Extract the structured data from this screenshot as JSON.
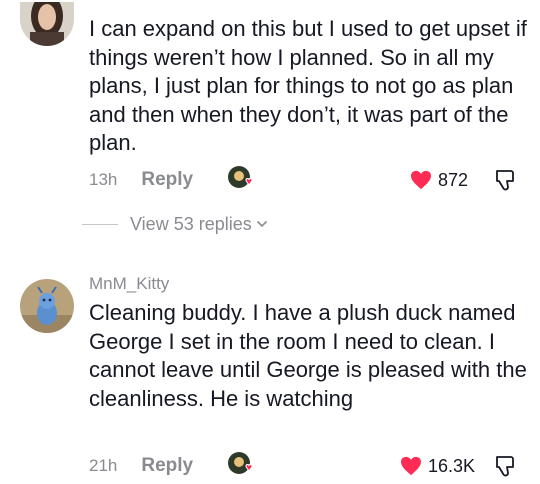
{
  "comments": [
    {
      "username": "",
      "text": "I can expand on this but I used to get upset if things weren’t how I planned. So in all my plans, I just plan for things to not go as plan and then when they don’t, it was part of the plan.",
      "time": "13h",
      "reply_label": "Reply",
      "like_count": "872",
      "view_replies_label": "View 53 replies"
    },
    {
      "username": "MnM_Kitty",
      "text": "Cleaning buddy. I have a plush duck named George I set in the room I need to clean. I cannot leave until George is pleased with the cleanliness. He is watching",
      "time": "21h",
      "reply_label": "Reply",
      "like_count": "16.3K"
    }
  ],
  "colors": {
    "heart": "#fe2c55",
    "muted_text": "#8a8b91",
    "primary_text": "#161823"
  },
  "icons": [
    "heart-icon",
    "dislike-icon",
    "chevron-down-icon",
    "creator-liked-avatar"
  ]
}
